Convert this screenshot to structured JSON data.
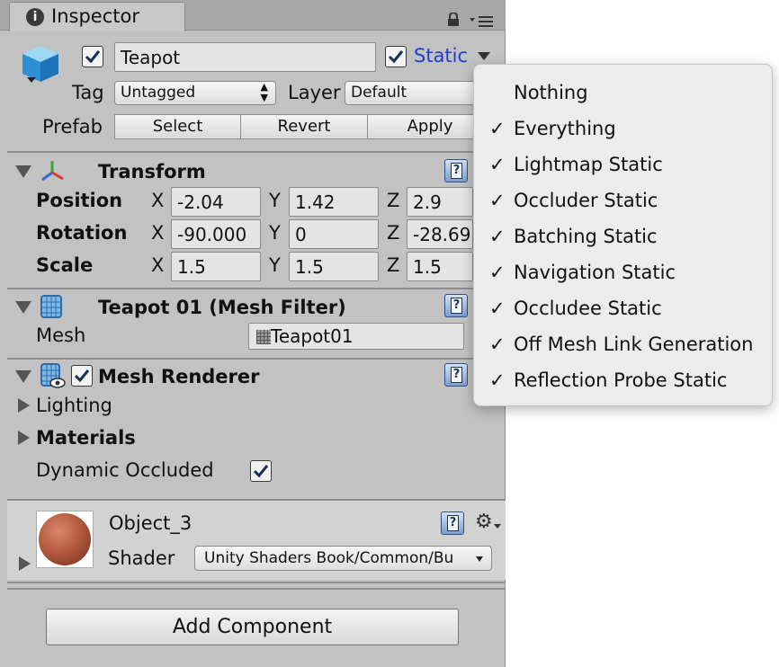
{
  "tab": {
    "title": "Inspector"
  },
  "object": {
    "enabled": true,
    "name": "Teapot",
    "static_label": "Static",
    "static_checked": true
  },
  "tag": {
    "label": "Tag",
    "value": "Untagged"
  },
  "layer": {
    "label": "Layer",
    "value": "Default"
  },
  "prefab": {
    "label": "Prefab",
    "select": "Select",
    "revert": "Revert",
    "apply": "Apply"
  },
  "transform": {
    "title": "Transform",
    "rows": [
      {
        "label": "Position",
        "x": "-2.04",
        "y": "1.42",
        "z": "2.9"
      },
      {
        "label": "Rotation",
        "x": "-90.000",
        "y": "0",
        "z": "-28.69"
      },
      {
        "label": "Scale",
        "x": "1.5",
        "y": "1.5",
        "z": "1.5"
      }
    ],
    "axes": {
      "x": "X",
      "y": "Y",
      "z": "Z"
    }
  },
  "mesh_filter": {
    "title": "Teapot 01 (Mesh Filter)",
    "mesh_label": "Mesh",
    "mesh_value": "Teapot01"
  },
  "mesh_renderer": {
    "title": "Mesh Renderer",
    "enabled": true,
    "lighting": "Lighting",
    "materials": "Materials",
    "dynamic_occluded": "Dynamic Occluded",
    "dynamic_occluded_checked": true
  },
  "material": {
    "name": "Object_3",
    "shader_label": "Shader",
    "shader_value": "Unity Shaders Book/Common/Bu"
  },
  "add_component": "Add Component",
  "static_menu": {
    "items": [
      {
        "label": "Nothing",
        "checked": false
      },
      {
        "label": "Everything",
        "checked": true
      },
      {
        "label": "Lightmap Static",
        "checked": true
      },
      {
        "label": "Occluder Static",
        "checked": true
      },
      {
        "label": "Batching Static",
        "checked": true
      },
      {
        "label": "Navigation Static",
        "checked": true
      },
      {
        "label": "Occludee Static",
        "checked": true
      },
      {
        "label": "Off Mesh Link Generation",
        "checked": true
      },
      {
        "label": "Reflection Probe Static",
        "checked": true
      }
    ]
  },
  "colors": {
    "static_blue": "#1a3fd1",
    "panel_bg": "#c2c2c2",
    "menu_bg": "#ececec"
  }
}
